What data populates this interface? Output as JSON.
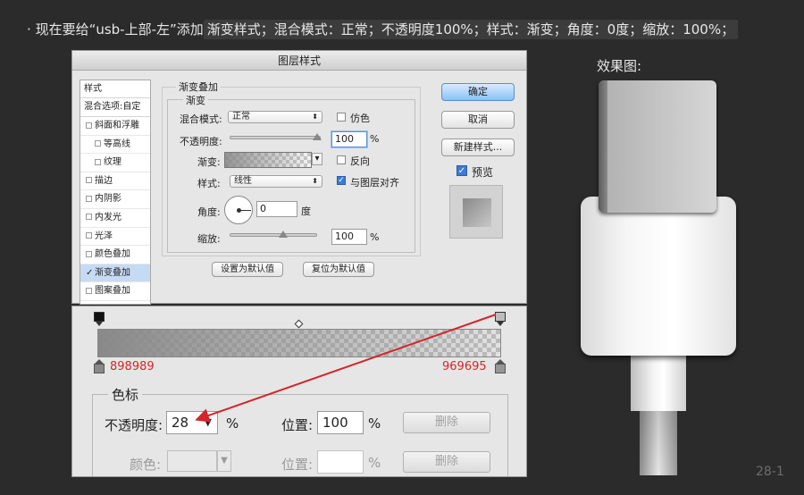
{
  "instruction": {
    "bullet": "·",
    "prefix": "现在要给“usb-上部-左”添加",
    "highlight": "渐变样式；混合模式：正常；不透明度100%；样式：渐变；角度：0度；缩放：100%；"
  },
  "dialog": {
    "title": "图层样式",
    "styles_header": "样式",
    "blend_options": "混合选项:自定",
    "style_items": [
      {
        "label": "斜面和浮雕",
        "checked": false,
        "sub": false,
        "selected": false
      },
      {
        "label": "等高线",
        "checked": false,
        "sub": true,
        "selected": false
      },
      {
        "label": "纹理",
        "checked": false,
        "sub": true,
        "selected": false
      },
      {
        "label": "描边",
        "checked": false,
        "sub": false,
        "selected": false
      },
      {
        "label": "内阴影",
        "checked": false,
        "sub": false,
        "selected": false
      },
      {
        "label": "内发光",
        "checked": false,
        "sub": false,
        "selected": false
      },
      {
        "label": "光泽",
        "checked": false,
        "sub": false,
        "selected": false
      },
      {
        "label": "颜色叠加",
        "checked": false,
        "sub": false,
        "selected": false
      },
      {
        "label": "渐变叠加",
        "checked": true,
        "sub": false,
        "selected": true
      },
      {
        "label": "图案叠加",
        "checked": false,
        "sub": false,
        "selected": false
      }
    ],
    "section_title": "渐变叠加",
    "sub_section": "渐变",
    "blend_mode_label": "混合模式:",
    "blend_mode_value": "正常",
    "dither_label": "仿色",
    "opacity_label": "不透明度:",
    "opacity_value": "100",
    "percent": "%",
    "gradient_label": "渐变:",
    "reverse_label": "反向",
    "style_label": "样式:",
    "style_value": "线性",
    "align_label": "与图层对齐",
    "angle_label": "角度:",
    "angle_value": "0",
    "degree_unit": "度",
    "scale_label": "缩放:",
    "scale_value": "100",
    "set_default": "设置为默认值",
    "reset_default": "复位为默认值",
    "ok": "确定",
    "cancel": "取消",
    "new_style": "新建样式...",
    "preview_label": "预览"
  },
  "gradient_editor": {
    "left_color": "898989",
    "right_color": "969695",
    "stops_title": "色标",
    "opacity_label": "不透明度:",
    "opacity_value": "28",
    "percent": "%",
    "location_label": "位置:",
    "location_value": "100",
    "delete_label": "删除",
    "color_label": "颜色:",
    "location_label_2": "位置:",
    "delete_label_2": "删除"
  },
  "effect": {
    "title": "效果图:"
  },
  "page_number": "28-1",
  "colors": {
    "accent_red": "#d3262a",
    "gradient_start": "#898989",
    "gradient_end": "#969695"
  }
}
